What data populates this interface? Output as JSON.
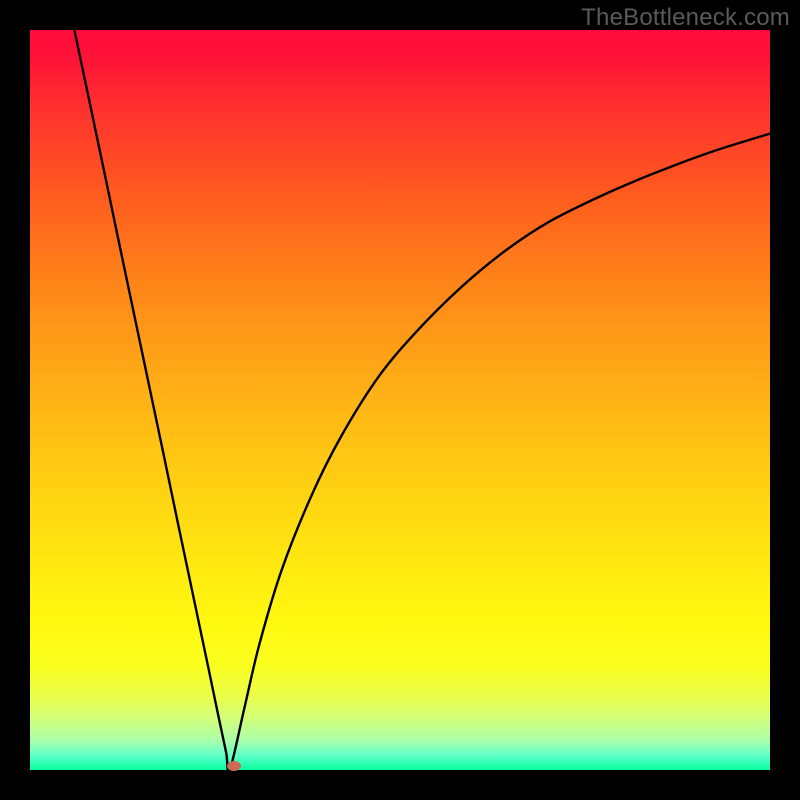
{
  "watermark": "TheBottleneck.com",
  "chart_data": {
    "type": "line",
    "title": "",
    "xlabel": "",
    "ylabel": "",
    "xlim": [
      0,
      1
    ],
    "ylim": [
      0,
      1
    ],
    "vertex_x": 0.27,
    "marker": {
      "x": 0.275,
      "y": 0.006,
      "color": "#cc6b56"
    },
    "series": [
      {
        "name": "left-branch",
        "x": [
          0.06,
          0.08,
          0.1,
          0.12,
          0.14,
          0.16,
          0.18,
          0.2,
          0.22,
          0.24,
          0.255,
          0.265,
          0.27
        ],
        "y": [
          1.0,
          0.905,
          0.81,
          0.714,
          0.619,
          0.524,
          0.429,
          0.333,
          0.238,
          0.143,
          0.071,
          0.024,
          0.0
        ]
      },
      {
        "name": "right-branch",
        "x": [
          0.27,
          0.29,
          0.31,
          0.34,
          0.38,
          0.42,
          0.47,
          0.52,
          0.58,
          0.64,
          0.7,
          0.77,
          0.84,
          0.92,
          1.0
        ],
        "y": [
          0.0,
          0.085,
          0.17,
          0.27,
          0.37,
          0.45,
          0.53,
          0.59,
          0.65,
          0.7,
          0.74,
          0.775,
          0.805,
          0.835,
          0.86
        ]
      }
    ],
    "background_gradient": {
      "top": "#ff0a3c",
      "mid": "#ffd412",
      "bottom": "#05ffa0"
    }
  }
}
